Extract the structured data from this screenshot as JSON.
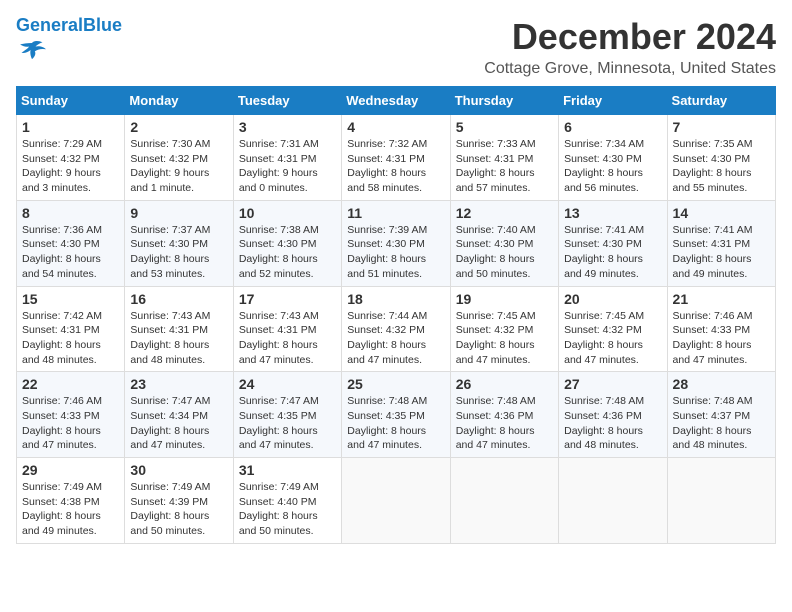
{
  "logo": {
    "text_general": "General",
    "text_blue": "Blue"
  },
  "title": "December 2024",
  "subtitle": "Cottage Grove, Minnesota, United States",
  "days_of_week": [
    "Sunday",
    "Monday",
    "Tuesday",
    "Wednesday",
    "Thursday",
    "Friday",
    "Saturday"
  ],
  "weeks": [
    [
      {
        "day": "1",
        "sunrise": "Sunrise: 7:29 AM",
        "sunset": "Sunset: 4:32 PM",
        "daylight": "Daylight: 9 hours and 3 minutes."
      },
      {
        "day": "2",
        "sunrise": "Sunrise: 7:30 AM",
        "sunset": "Sunset: 4:32 PM",
        "daylight": "Daylight: 9 hours and 1 minute."
      },
      {
        "day": "3",
        "sunrise": "Sunrise: 7:31 AM",
        "sunset": "Sunset: 4:31 PM",
        "daylight": "Daylight: 9 hours and 0 minutes."
      },
      {
        "day": "4",
        "sunrise": "Sunrise: 7:32 AM",
        "sunset": "Sunset: 4:31 PM",
        "daylight": "Daylight: 8 hours and 58 minutes."
      },
      {
        "day": "5",
        "sunrise": "Sunrise: 7:33 AM",
        "sunset": "Sunset: 4:31 PM",
        "daylight": "Daylight: 8 hours and 57 minutes."
      },
      {
        "day": "6",
        "sunrise": "Sunrise: 7:34 AM",
        "sunset": "Sunset: 4:30 PM",
        "daylight": "Daylight: 8 hours and 56 minutes."
      },
      {
        "day": "7",
        "sunrise": "Sunrise: 7:35 AM",
        "sunset": "Sunset: 4:30 PM",
        "daylight": "Daylight: 8 hours and 55 minutes."
      }
    ],
    [
      {
        "day": "8",
        "sunrise": "Sunrise: 7:36 AM",
        "sunset": "Sunset: 4:30 PM",
        "daylight": "Daylight: 8 hours and 54 minutes."
      },
      {
        "day": "9",
        "sunrise": "Sunrise: 7:37 AM",
        "sunset": "Sunset: 4:30 PM",
        "daylight": "Daylight: 8 hours and 53 minutes."
      },
      {
        "day": "10",
        "sunrise": "Sunrise: 7:38 AM",
        "sunset": "Sunset: 4:30 PM",
        "daylight": "Daylight: 8 hours and 52 minutes."
      },
      {
        "day": "11",
        "sunrise": "Sunrise: 7:39 AM",
        "sunset": "Sunset: 4:30 PM",
        "daylight": "Daylight: 8 hours and 51 minutes."
      },
      {
        "day": "12",
        "sunrise": "Sunrise: 7:40 AM",
        "sunset": "Sunset: 4:30 PM",
        "daylight": "Daylight: 8 hours and 50 minutes."
      },
      {
        "day": "13",
        "sunrise": "Sunrise: 7:41 AM",
        "sunset": "Sunset: 4:30 PM",
        "daylight": "Daylight: 8 hours and 49 minutes."
      },
      {
        "day": "14",
        "sunrise": "Sunrise: 7:41 AM",
        "sunset": "Sunset: 4:31 PM",
        "daylight": "Daylight: 8 hours and 49 minutes."
      }
    ],
    [
      {
        "day": "15",
        "sunrise": "Sunrise: 7:42 AM",
        "sunset": "Sunset: 4:31 PM",
        "daylight": "Daylight: 8 hours and 48 minutes."
      },
      {
        "day": "16",
        "sunrise": "Sunrise: 7:43 AM",
        "sunset": "Sunset: 4:31 PM",
        "daylight": "Daylight: 8 hours and 48 minutes."
      },
      {
        "day": "17",
        "sunrise": "Sunrise: 7:43 AM",
        "sunset": "Sunset: 4:31 PM",
        "daylight": "Daylight: 8 hours and 47 minutes."
      },
      {
        "day": "18",
        "sunrise": "Sunrise: 7:44 AM",
        "sunset": "Sunset: 4:32 PM",
        "daylight": "Daylight: 8 hours and 47 minutes."
      },
      {
        "day": "19",
        "sunrise": "Sunrise: 7:45 AM",
        "sunset": "Sunset: 4:32 PM",
        "daylight": "Daylight: 8 hours and 47 minutes."
      },
      {
        "day": "20",
        "sunrise": "Sunrise: 7:45 AM",
        "sunset": "Sunset: 4:32 PM",
        "daylight": "Daylight: 8 hours and 47 minutes."
      },
      {
        "day": "21",
        "sunrise": "Sunrise: 7:46 AM",
        "sunset": "Sunset: 4:33 PM",
        "daylight": "Daylight: 8 hours and 47 minutes."
      }
    ],
    [
      {
        "day": "22",
        "sunrise": "Sunrise: 7:46 AM",
        "sunset": "Sunset: 4:33 PM",
        "daylight": "Daylight: 8 hours and 47 minutes."
      },
      {
        "day": "23",
        "sunrise": "Sunrise: 7:47 AM",
        "sunset": "Sunset: 4:34 PM",
        "daylight": "Daylight: 8 hours and 47 minutes."
      },
      {
        "day": "24",
        "sunrise": "Sunrise: 7:47 AM",
        "sunset": "Sunset: 4:35 PM",
        "daylight": "Daylight: 8 hours and 47 minutes."
      },
      {
        "day": "25",
        "sunrise": "Sunrise: 7:48 AM",
        "sunset": "Sunset: 4:35 PM",
        "daylight": "Daylight: 8 hours and 47 minutes."
      },
      {
        "day": "26",
        "sunrise": "Sunrise: 7:48 AM",
        "sunset": "Sunset: 4:36 PM",
        "daylight": "Daylight: 8 hours and 47 minutes."
      },
      {
        "day": "27",
        "sunrise": "Sunrise: 7:48 AM",
        "sunset": "Sunset: 4:36 PM",
        "daylight": "Daylight: 8 hours and 48 minutes."
      },
      {
        "day": "28",
        "sunrise": "Sunrise: 7:48 AM",
        "sunset": "Sunset: 4:37 PM",
        "daylight": "Daylight: 8 hours and 48 minutes."
      }
    ],
    [
      {
        "day": "29",
        "sunrise": "Sunrise: 7:49 AM",
        "sunset": "Sunset: 4:38 PM",
        "daylight": "Daylight: 8 hours and 49 minutes."
      },
      {
        "day": "30",
        "sunrise": "Sunrise: 7:49 AM",
        "sunset": "Sunset: 4:39 PM",
        "daylight": "Daylight: 8 hours and 50 minutes."
      },
      {
        "day": "31",
        "sunrise": "Sunrise: 7:49 AM",
        "sunset": "Sunset: 4:40 PM",
        "daylight": "Daylight: 8 hours and 50 minutes."
      },
      null,
      null,
      null,
      null
    ]
  ]
}
